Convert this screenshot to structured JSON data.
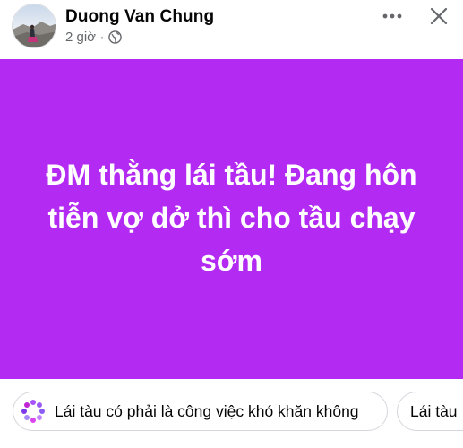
{
  "post": {
    "author": "Duong Van Chung",
    "time": "2 giờ",
    "separator": "·",
    "privacy_icon": "globe-icon",
    "text": "ĐM thằng lái tầu! Đang hôn tiễn vợ dở thì cho tầu chạy sớm",
    "background_color": "#B32AF3",
    "text_color": "#FFFFFF"
  },
  "header": {
    "more_icon": "more-options-icon",
    "close_icon": "close-icon"
  },
  "suggestions": [
    {
      "icon": "meta-ai-icon",
      "label": "Lái tàu có phải là công việc khó khăn không"
    },
    {
      "label": "Lái tàu"
    }
  ],
  "colors": {
    "name": "#050505",
    "meta": "#65676B",
    "chip_border": "#D3D6DB",
    "accent": "#B32AF3"
  }
}
